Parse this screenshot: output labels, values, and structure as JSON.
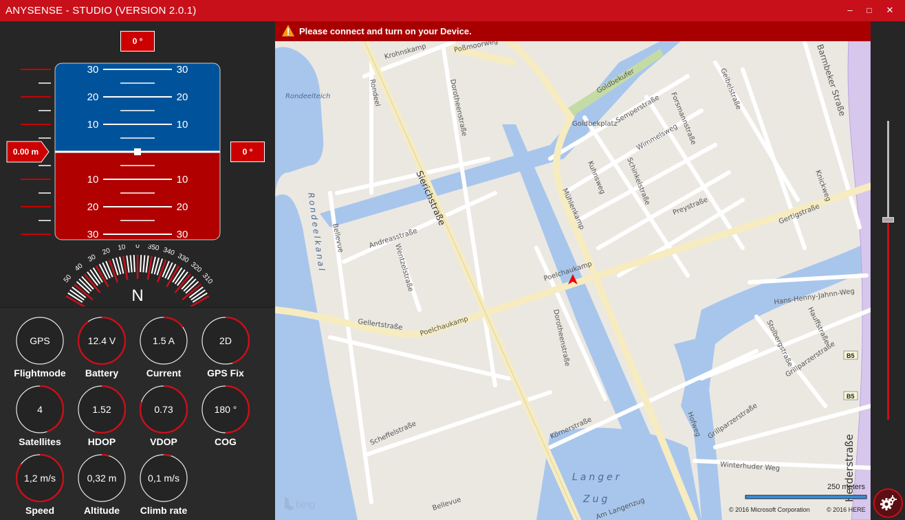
{
  "app": {
    "title": "ANYSENSE - STUDIO (VERSION 2.0.1)",
    "minimize": "–",
    "maximize": "□",
    "close": "✕"
  },
  "attitude": {
    "heading_top": "0 °",
    "altitude_left": "0.00 m",
    "roll_right": "0 °",
    "pitch_labels": [
      "30",
      "20",
      "10",
      "10",
      "20",
      "30"
    ]
  },
  "compass": {
    "north": "N",
    "labels": [
      "50",
      "40",
      "30",
      "20",
      "10",
      "0",
      "350",
      "340",
      "330",
      "320",
      "310"
    ]
  },
  "gauges": [
    {
      "value": "GPS",
      "label": "Flightmode",
      "fill": 0
    },
    {
      "value": "12.4 V",
      "label": "Battery",
      "fill": 0.9
    },
    {
      "value": "1.5 A",
      "label": "Current",
      "fill": 0.15
    },
    {
      "value": "2D",
      "label": "GPS Fix",
      "fill": 0.45
    },
    {
      "value": "4",
      "label": "Satellites",
      "fill": 0.45
    },
    {
      "value": "1.52",
      "label": "HDOP",
      "fill": 0.55
    },
    {
      "value": "0.73",
      "label": "VDOP",
      "fill": 0.8
    },
    {
      "value": "180 °",
      "label": "COG",
      "fill": 0.5
    },
    {
      "value": "1,2 m/s",
      "label": "Speed",
      "fill": 0.85
    },
    {
      "value": "0,32 m",
      "label": "Altitude",
      "fill": 0.05
    },
    {
      "value": "0,1 m/s",
      "label": "Climb rate",
      "fill": 0.05
    }
  ],
  "alert": {
    "text": "Please connect and turn on your Device."
  },
  "map": {
    "labels": {
      "possmoorweg": "Poßmoorweg",
      "krohnskamp": "Krohnskamp",
      "rondeelteich": "Rondeelteich",
      "rondeel": "Rondeel",
      "dorotheenstrasse1": "Dorotheenstraße",
      "dorotheenstrasse2": "Dorotheenstraße",
      "sierichstrasse": "Sierichstraße",
      "rondeelkanal": "Rondeelkanal",
      "bellevue1": "Bellevue",
      "bellevue2": "Bellevue",
      "andreasstrasse": "Andreasstraße",
      "wentzelstrasse": "Wentzelstraße",
      "gellertstrasse": "Gellertstraße",
      "poelchaukamp1": "Poelchaukamp",
      "poelchaukamp2": "Poelchaukamp",
      "muehlenkamp": "Mühlenkamp",
      "kuhnsweg": "Kuhnsweg",
      "schinkelstrasse": "Schinkelstraße",
      "goldbekufer": "Goldbekufer",
      "goldbekplatz": "Goldbekplatz",
      "semperstrasse": "Semperstraße",
      "forsmannstrasse": "Forsmannstraße",
      "wimmelsweg": "Wimmelsweg",
      "geibelstrasse": "Geibelstraße",
      "barmbeker": "Barmbeker Straße",
      "knickweg": "Knickweg",
      "preystrasse": "Preystraße",
      "gertigstrasse": "Gertigstraße",
      "hanshenny": "Hans-Henny-Jahnn-Weg",
      "hauffstrasse": "Hauffstraße",
      "stolbergstrasse": "Stolbergstraße",
      "grillparzer1": "Grillparzerstraße",
      "grillparzer2": "Grillparzerstraße",
      "b5a": "B5",
      "b5b": "B5",
      "herderstrasse": "Herderstraße",
      "hofweg": "Hofweg",
      "koernerstrasse": "Körnerstraße",
      "scheffelstrasse": "Scheffelstraße",
      "langer": "Langer",
      "zug": "Zug",
      "winterhuder": "Winterhuder Weg",
      "amlangenzug": "Am Langenzug"
    },
    "bing": "bing",
    "scale": "250 meters",
    "copyright_ms": "© 2016 Microsoft Corporation",
    "copyright_here": "© 2016 HERE"
  },
  "zoom": {
    "level": 0.67
  },
  "colors": {
    "brand_red": "#c8101a",
    "sky_blue": "#00539b",
    "ground_red": "#b00000",
    "water": "#a8c6ec",
    "road_major": "#f6ecc0",
    "map_bg": "#ebe8e2"
  }
}
